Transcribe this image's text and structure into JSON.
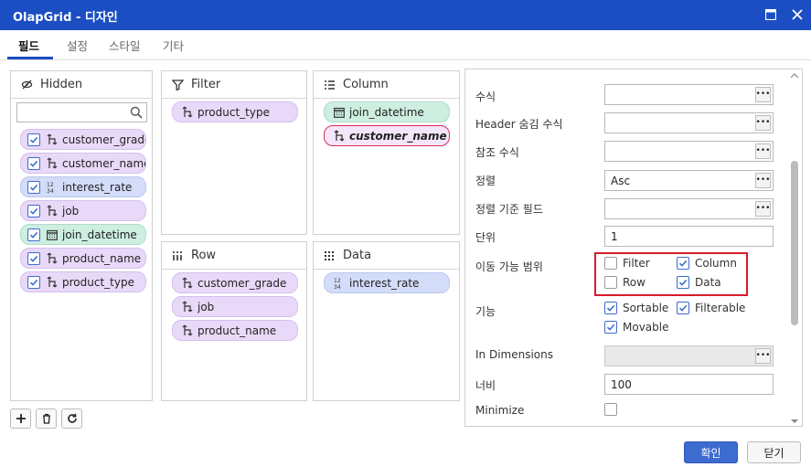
{
  "window": {
    "title": "OlapGrid - 디자인"
  },
  "tabs": [
    {
      "label": "필드"
    },
    {
      "label": "설정"
    },
    {
      "label": "스타일"
    },
    {
      "label": "기타"
    }
  ],
  "panels": {
    "hidden": {
      "title": "Hidden",
      "search_placeholder": "",
      "items": [
        {
          "label": "customer_grade",
          "type": "dimension",
          "checked": true
        },
        {
          "label": "customer_name",
          "type": "dimension",
          "checked": true
        },
        {
          "label": "interest_rate",
          "type": "measure",
          "checked": true
        },
        {
          "label": "job",
          "type": "dimension",
          "checked": true
        },
        {
          "label": "join_datetime",
          "type": "date",
          "checked": true
        },
        {
          "label": "product_name",
          "type": "dimension",
          "checked": true
        },
        {
          "label": "product_type",
          "type": "dimension",
          "checked": true
        }
      ]
    },
    "filter": {
      "title": "Filter",
      "items": [
        {
          "label": "product_type"
        }
      ]
    },
    "column": {
      "title": "Column",
      "items": [
        {
          "label": "join_datetime"
        },
        {
          "label": "customer_name",
          "selected": true
        }
      ]
    },
    "row": {
      "title": "Row",
      "items": [
        {
          "label": "customer_grade"
        },
        {
          "label": "job"
        },
        {
          "label": "product_name"
        }
      ]
    },
    "data": {
      "title": "Data",
      "items": [
        {
          "label": "interest_rate"
        }
      ]
    }
  },
  "properties": {
    "formula": {
      "label": "수식",
      "value": ""
    },
    "header_hide_formula": {
      "label": "Header 숨김 수식",
      "value": ""
    },
    "ref_formula": {
      "label": "참조 수식",
      "value": ""
    },
    "sort": {
      "label": "정렬",
      "value": "Asc"
    },
    "sort_field": {
      "label": "정렬 기준 필드",
      "value": ""
    },
    "unit": {
      "label": "단위",
      "value": "1"
    },
    "move_range": {
      "label": "이동 가능 범위",
      "options": [
        {
          "label": "Filter",
          "checked": false
        },
        {
          "label": "Column",
          "checked": true
        },
        {
          "label": "Row",
          "checked": false
        },
        {
          "label": "Data",
          "checked": true
        }
      ]
    },
    "features": {
      "label": "기능",
      "options": [
        {
          "label": "Sortable",
          "checked": true
        },
        {
          "label": "Filterable",
          "checked": true
        },
        {
          "label": "Movable",
          "checked": true
        }
      ]
    },
    "in_dimensions": {
      "label": "In Dimensions",
      "value": ""
    },
    "width": {
      "label": "너비",
      "value": "100"
    },
    "minimize": {
      "label": "Minimize",
      "checked": false
    }
  },
  "footer": {
    "ok_label": "확인",
    "close_label": "닫기"
  },
  "colors": {
    "title_bar": "#1b4ec2",
    "accent": "#3e6bd0",
    "highlight": "#d81b2c",
    "dim_chip": "#e8d9f8",
    "measure_chip": "#d3dcf8",
    "date_chip": "#cdeee0"
  }
}
